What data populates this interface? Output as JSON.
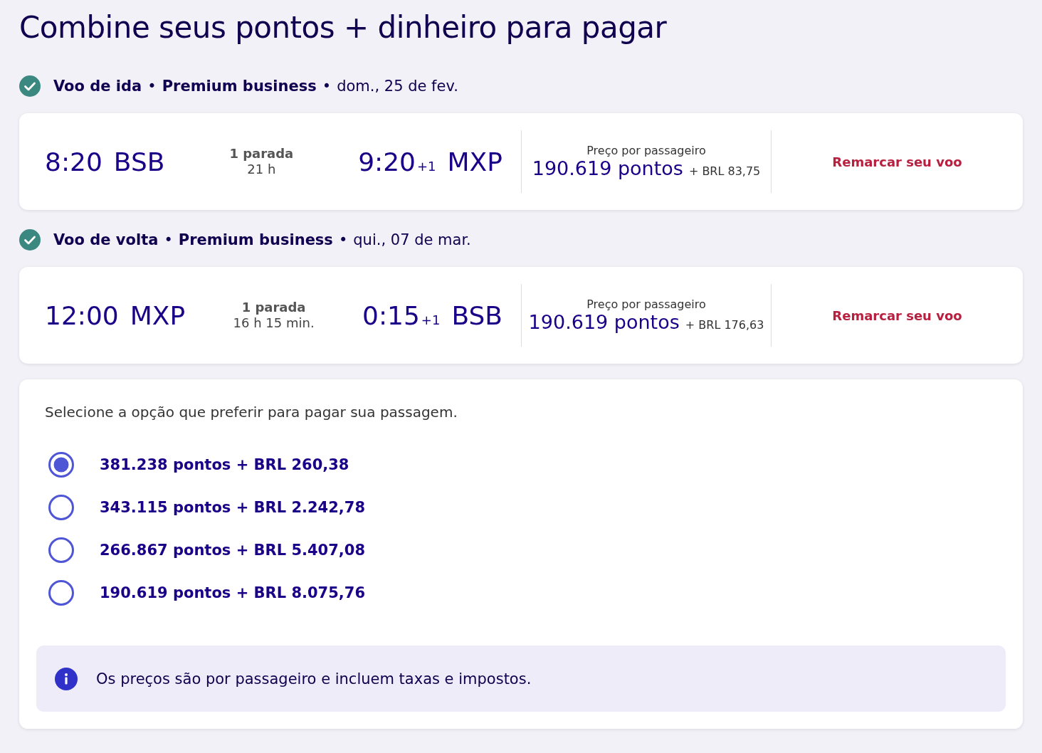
{
  "title": "Combine seus pontos + dinheiro para pagar",
  "flights": [
    {
      "heading": {
        "confirmed": true,
        "direction": "Voo de ida",
        "separator_1": "•",
        "cabin": "Premium business",
        "separator_2": "•",
        "date": "dom., 25 de fev."
      },
      "departure": {
        "time": "8:20",
        "airport": "BSB"
      },
      "stops": "1 parada",
      "duration": "21 h",
      "arrival": {
        "time": "9:20",
        "day_offset": "+1",
        "airport": "MXP"
      },
      "price_label": "Preço por passageiro",
      "points": "190.619 pontos",
      "cash": "+ BRL 83,75",
      "action": "Remarcar seu voo"
    },
    {
      "heading": {
        "confirmed": true,
        "direction": "Voo de volta",
        "separator_1": "•",
        "cabin": "Premium business",
        "separator_2": "•",
        "date": "qui., 07 de mar."
      },
      "departure": {
        "time": "12:00",
        "airport": "MXP"
      },
      "stops": "1 parada",
      "duration": "16 h 15 min.",
      "arrival": {
        "time": "0:15",
        "day_offset": "+1",
        "airport": "BSB"
      },
      "price_label": "Preço por passageiro",
      "points": "190.619 pontos",
      "cash": "+ BRL 176,63",
      "action": "Remarcar seu voo"
    }
  ],
  "payment": {
    "prompt": "Selecione a opção que preferir para pagar sua passagem.",
    "options": [
      {
        "label": "381.238 pontos + BRL 260,38",
        "selected": true
      },
      {
        "label": "343.115 pontos + BRL 2.242,78",
        "selected": false
      },
      {
        "label": "266.867 pontos + BRL 5.407,08",
        "selected": false
      },
      {
        "label": "190.619 pontos + BRL 8.075,76",
        "selected": false
      }
    ],
    "note": "Os preços são por passageiro e incluem taxas e impostos."
  }
}
